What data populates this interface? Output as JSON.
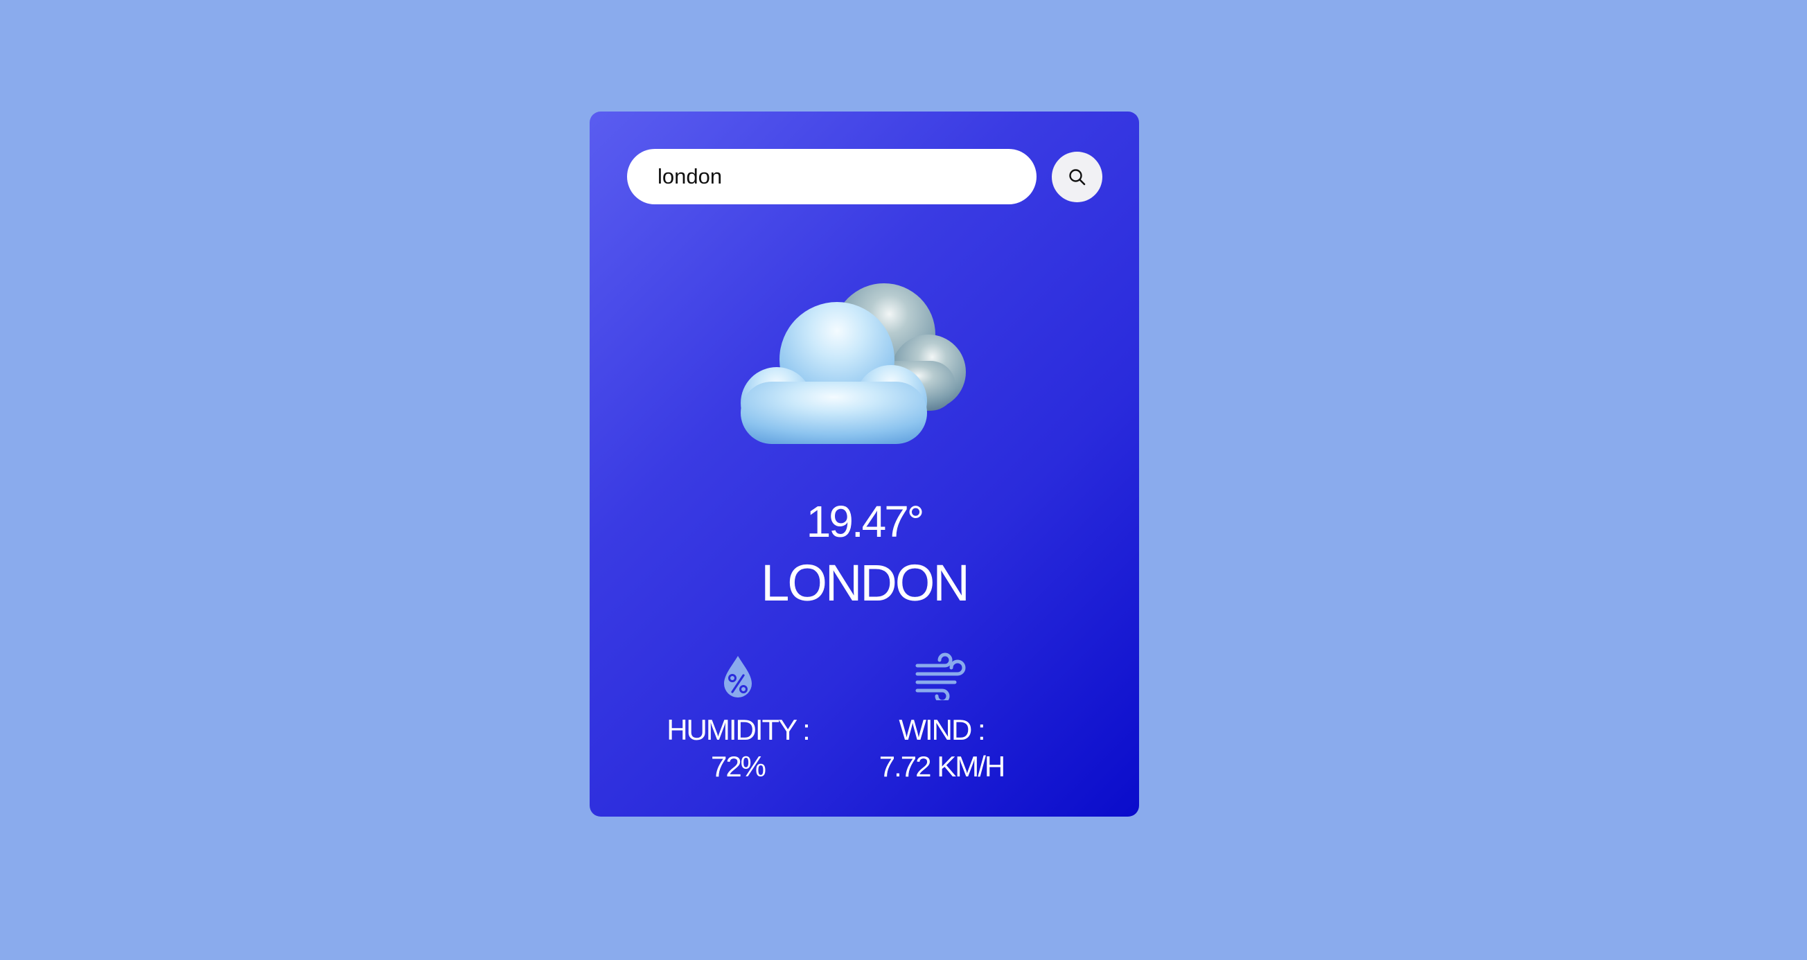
{
  "search": {
    "value": "london",
    "button_icon": "search-icon"
  },
  "weather": {
    "icon": "cloudy-icon",
    "temperature": "19.47°",
    "city": "LONDON"
  },
  "stats": {
    "humidity": {
      "icon": "humidity-drop-icon",
      "label": "HUMIDITY :",
      "value": "72%"
    },
    "wind": {
      "icon": "wind-icon",
      "label": "WIND :",
      "value": "7.72 KM/H"
    }
  },
  "colors": {
    "page_background": "#8aabed",
    "card_gradient_start": "#5a5df0",
    "card_gradient_end": "#0a0ccb",
    "stat_icon": "#8aabed"
  }
}
